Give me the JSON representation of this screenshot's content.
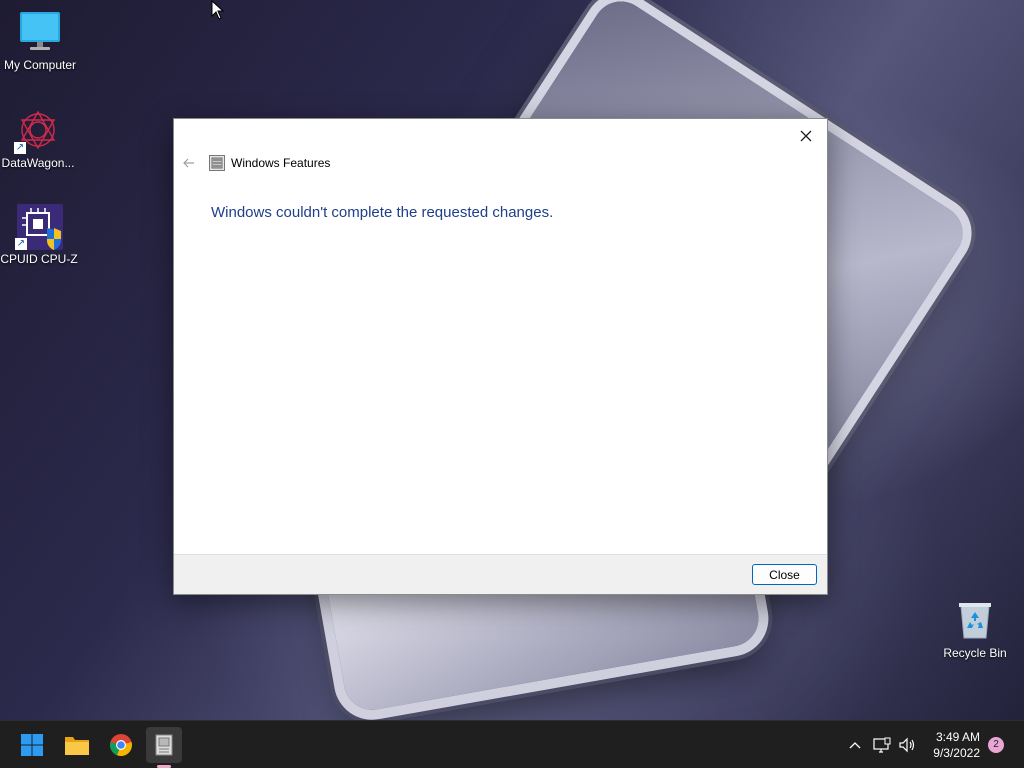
{
  "desktop": {
    "icons": [
      {
        "label": "My Computer",
        "icon": "monitor-icon"
      },
      {
        "label": "DataWagon...",
        "icon": "datawagon-icon"
      },
      {
        "label": "CPUID CPU-Z",
        "icon": "cpuz-icon"
      },
      {
        "label": "Recycle Bin",
        "icon": "recycle-bin-icon"
      }
    ]
  },
  "dialog": {
    "title": "Windows Features",
    "message": "Windows couldn't complete the requested changes.",
    "close_button_label": "Close",
    "message_color": "#1e3f8a"
  },
  "taskbar": {
    "apps": [
      {
        "name": "Start",
        "icon": "windows-logo-icon"
      },
      {
        "name": "File Explorer",
        "icon": "folder-icon"
      },
      {
        "name": "Google Chrome",
        "icon": "chrome-icon"
      },
      {
        "name": "Windows Features",
        "icon": "windows-features-icon",
        "active": true
      }
    ],
    "clock": {
      "time": "3:49 AM",
      "date": "9/3/2022"
    },
    "notification_count": "2"
  }
}
